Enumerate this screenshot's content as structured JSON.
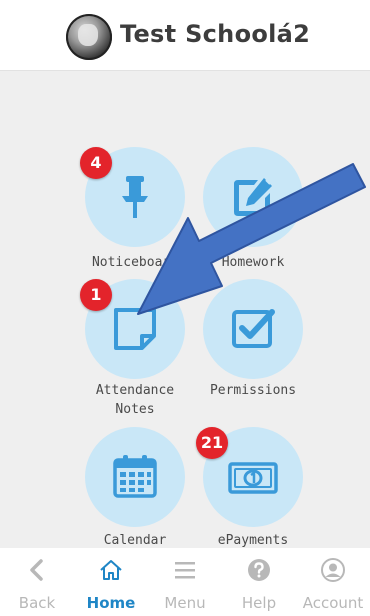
{
  "header": {
    "school_name": "Test Schoolá2"
  },
  "tiles": [
    {
      "label": "Noticeboard",
      "badge": "4"
    },
    {
      "label": "Homework",
      "badge": ""
    },
    {
      "label": "Attendance Notes",
      "badge": "1"
    },
    {
      "label": "Permissions",
      "badge": ""
    },
    {
      "label": "Calendar",
      "badge": ""
    },
    {
      "label": "ePayments",
      "badge": "21"
    }
  ],
  "tile_icons": [
    "pushpin-icon",
    "pencil-note-icon",
    "sticky-note-icon",
    "checkbox-icon",
    "calendar-icon",
    "banknote-icon"
  ],
  "bottom_nav": [
    {
      "label": "Back",
      "icon": "chevron-left-icon",
      "active": false
    },
    {
      "label": "Home",
      "icon": "home-icon",
      "active": true
    },
    {
      "label": "Menu",
      "icon": "menu-icon",
      "active": false
    },
    {
      "label": "Help",
      "icon": "help-icon",
      "active": false
    },
    {
      "label": "Account",
      "icon": "account-icon",
      "active": false
    }
  ],
  "colors": {
    "tile_circle": "#c9e7f7",
    "icon_blue": "#3a9ad9",
    "badge_red": "#e3242b",
    "nav_active": "#1f86c6",
    "nav_inactive": "#b8b8b8",
    "arrow_blue": "#4472c4",
    "background": "#efefef"
  }
}
